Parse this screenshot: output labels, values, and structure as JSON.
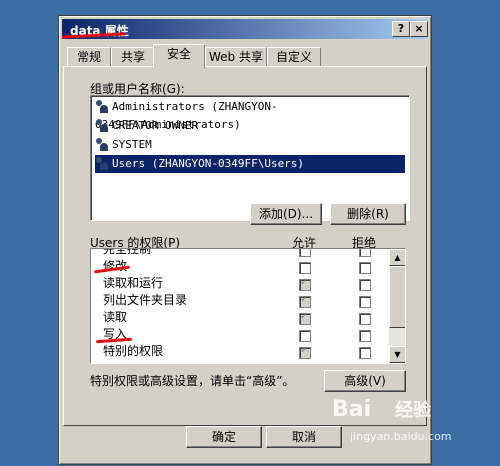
{
  "window": {
    "title": "data 属性",
    "help_label": "?",
    "close_label": "×"
  },
  "tabs": [
    {
      "label": "常规"
    },
    {
      "label": "共享"
    },
    {
      "label": "安全"
    },
    {
      "label": "Web 共享"
    },
    {
      "label": "自定义"
    }
  ],
  "groups": {
    "label": "组或用户名称(G):",
    "items": [
      {
        "label": "Administrators (ZHANGYON-0349FF\\Administrators)"
      },
      {
        "label": "CREATOR OWNER"
      },
      {
        "label": "SYSTEM"
      },
      {
        "label": "Users (ZHANGYON-0349FF\\Users)"
      }
    ],
    "add_label": "添加(D)...",
    "remove_label": "删除(R)"
  },
  "permissions": {
    "label": "Users 的权限(P)",
    "allow_header": "允许",
    "deny_header": "拒绝",
    "rows": [
      {
        "label": "完全控制"
      },
      {
        "label": "修改"
      },
      {
        "label": "读取和运行"
      },
      {
        "label": "列出文件夹目录"
      },
      {
        "label": "读取"
      },
      {
        "label": "写入"
      },
      {
        "label": "特别的权限"
      }
    ]
  },
  "advanced": {
    "hint": "特别权限或高级设置，请单击“高级”。",
    "button_label": "高级(V)"
  },
  "footer": {
    "ok_label": "确定",
    "cancel_label": "取消"
  },
  "watermark": {
    "brand": "Bai",
    "suffix": "经验",
    "url": "jingyan.baidu.com"
  },
  "colors": {
    "selection": "#0a246a",
    "annotation_red": "#e01010"
  }
}
